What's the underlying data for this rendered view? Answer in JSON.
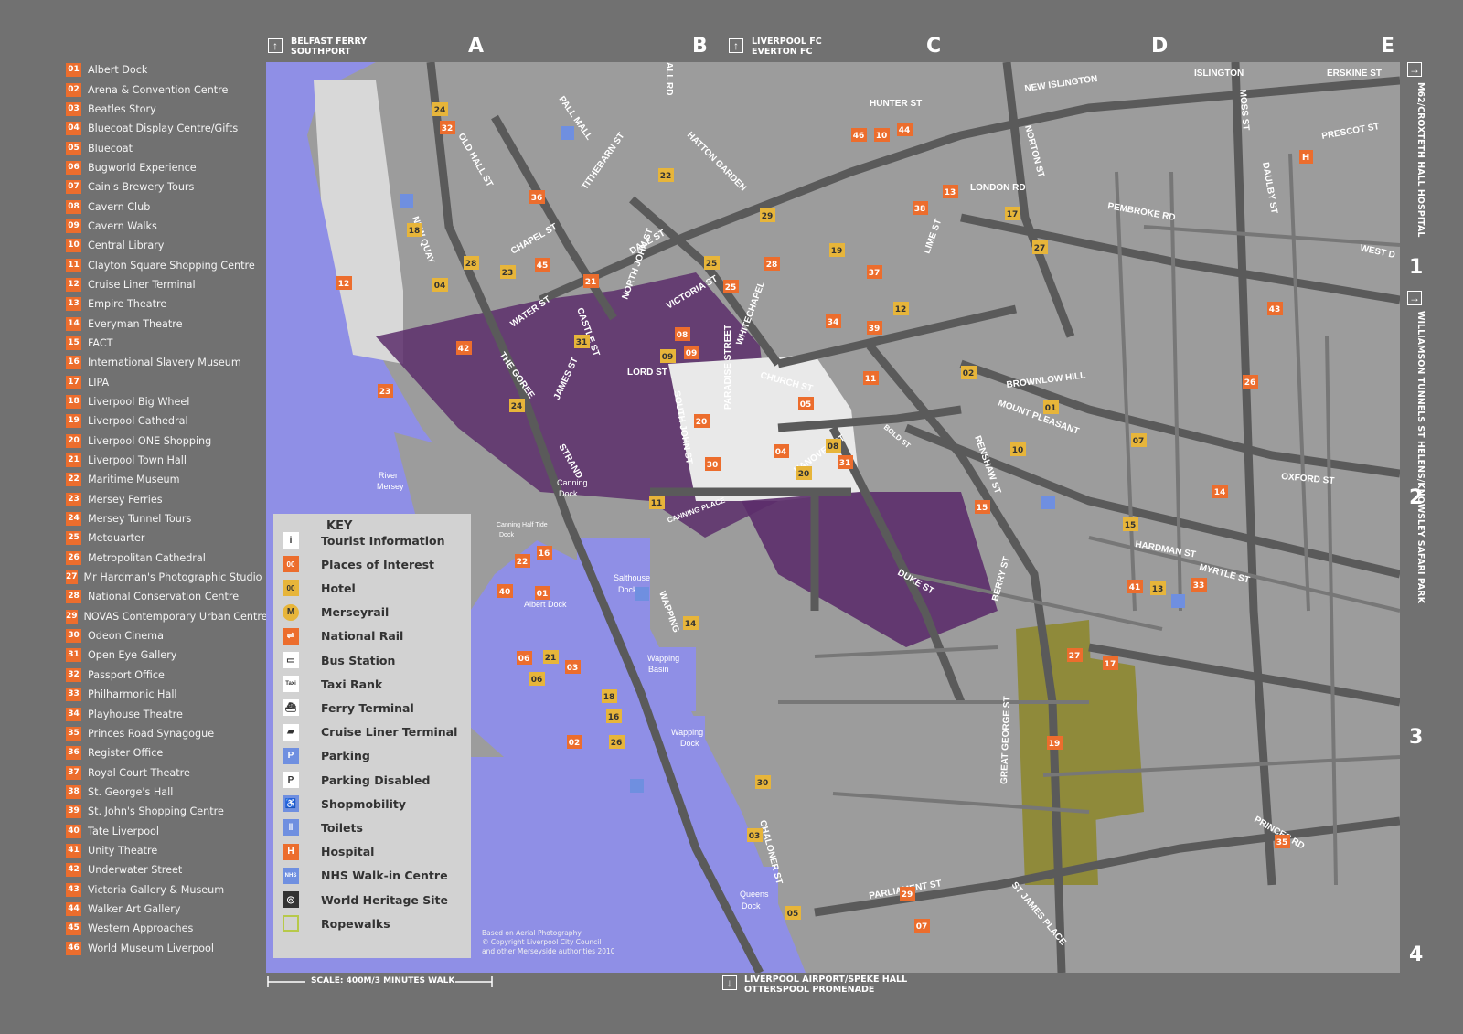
{
  "legend": [
    {
      "num": "01",
      "label": "Albert Dock"
    },
    {
      "num": "02",
      "label": "Arena & Convention Centre"
    },
    {
      "num": "03",
      "label": "Beatles Story"
    },
    {
      "num": "04",
      "label": "Bluecoat Display Centre/Gifts"
    },
    {
      "num": "05",
      "label": "Bluecoat"
    },
    {
      "num": "06",
      "label": "Bugworld Experience"
    },
    {
      "num": "07",
      "label": "Cain's Brewery Tours"
    },
    {
      "num": "08",
      "label": "Cavern Club"
    },
    {
      "num": "09",
      "label": "Cavern Walks"
    },
    {
      "num": "10",
      "label": "Central Library"
    },
    {
      "num": "11",
      "label": "Clayton Square Shopping Centre"
    },
    {
      "num": "12",
      "label": "Cruise Liner Terminal"
    },
    {
      "num": "13",
      "label": "Empire Theatre"
    },
    {
      "num": "14",
      "label": "Everyman Theatre"
    },
    {
      "num": "15",
      "label": "FACT"
    },
    {
      "num": "16",
      "label": "International Slavery Museum"
    },
    {
      "num": "17",
      "label": "LIPA"
    },
    {
      "num": "18",
      "label": "Liverpool Big Wheel"
    },
    {
      "num": "19",
      "label": "Liverpool Cathedral"
    },
    {
      "num": "20",
      "label": "Liverpool ONE Shopping"
    },
    {
      "num": "21",
      "label": "Liverpool Town Hall"
    },
    {
      "num": "22",
      "label": "Maritime Museum"
    },
    {
      "num": "23",
      "label": "Mersey Ferries"
    },
    {
      "num": "24",
      "label": "Mersey Tunnel Tours"
    },
    {
      "num": "25",
      "label": "Metquarter"
    },
    {
      "num": "26",
      "label": "Metropolitan Cathedral"
    },
    {
      "num": "27",
      "label": "Mr Hardman's Photographic Studio"
    },
    {
      "num": "28",
      "label": "National Conservation Centre"
    },
    {
      "num": "29",
      "label": "NOVAS Contemporary Urban Centre"
    },
    {
      "num": "30",
      "label": "Odeon Cinema"
    },
    {
      "num": "31",
      "label": "Open Eye Gallery"
    },
    {
      "num": "32",
      "label": "Passport Office"
    },
    {
      "num": "33",
      "label": "Philharmonic Hall"
    },
    {
      "num": "34",
      "label": "Playhouse Theatre"
    },
    {
      "num": "35",
      "label": "Princes Road Synagogue"
    },
    {
      "num": "36",
      "label": "Register Office"
    },
    {
      "num": "37",
      "label": "Royal Court Theatre"
    },
    {
      "num": "38",
      "label": "St. George's Hall"
    },
    {
      "num": "39",
      "label": "St. John's Shopping Centre"
    },
    {
      "num": "40",
      "label": "Tate Liverpool"
    },
    {
      "num": "41",
      "label": "Unity Theatre"
    },
    {
      "num": "42",
      "label": "Underwater Street"
    },
    {
      "num": "43",
      "label": "Victoria Gallery & Museum"
    },
    {
      "num": "44",
      "label": "Walker Art Gallery"
    },
    {
      "num": "45",
      "label": "Western Approaches"
    },
    {
      "num": "46",
      "label": "World Museum Liverpool"
    }
  ],
  "grid": {
    "columns": [
      "A",
      "B",
      "C",
      "D",
      "E"
    ],
    "rows": [
      "1",
      "2",
      "3",
      "4"
    ]
  },
  "edges": {
    "top_left": [
      "BELFAST FERRY",
      "SOUTHPORT"
    ],
    "top_mid": [
      "LIVERPOOL FC",
      "EVERTON FC"
    ],
    "right_top": "M62/CROXTETH HALL HOSPITAL",
    "right_mid": "WILLIAMSON TUNNELS ST HELENS/KNOWSLEY SAFARI PARK",
    "bottom": [
      "LIVERPOOL AIRPORT/SPEKE HALL",
      "OTTERSPOOL PROMENADE"
    ]
  },
  "key": {
    "title": "KEY",
    "items": [
      {
        "icon": "tourist-info-icon",
        "sym": "i",
        "label": "Tourist Information"
      },
      {
        "icon": "places-of-interest-icon",
        "sym": "00",
        "label": "Places of Interest"
      },
      {
        "icon": "hotel-icon",
        "sym": "00",
        "label": "Hotel"
      },
      {
        "icon": "merseyrail-icon",
        "sym": "M",
        "label": "Merseyrail"
      },
      {
        "icon": "national-rail-icon",
        "sym": "⇌",
        "label": "National Rail"
      },
      {
        "icon": "bus-station-icon",
        "sym": "▭",
        "label": "Bus Station"
      },
      {
        "icon": "taxi-rank-icon",
        "sym": "Taxi",
        "label": "Taxi Rank"
      },
      {
        "icon": "ferry-terminal-icon",
        "sym": "⛴",
        "label": "Ferry Terminal"
      },
      {
        "icon": "cruise-liner-terminal-icon",
        "sym": "▰",
        "label": "Cruise Liner Terminal"
      },
      {
        "icon": "parking-icon",
        "sym": "P",
        "label": "Parking"
      },
      {
        "icon": "parking-disabled-icon",
        "sym": "P",
        "label": "Parking Disabled"
      },
      {
        "icon": "shopmobility-icon",
        "sym": "♿",
        "label": "Shopmobility"
      },
      {
        "icon": "toilets-icon",
        "sym": "ǁ",
        "label": "Toilets"
      },
      {
        "icon": "hospital-icon",
        "sym": "H",
        "label": "Hospital"
      },
      {
        "icon": "nhs-walkin-icon",
        "sym": "NHS",
        "label": "NHS Walk-in Centre"
      },
      {
        "icon": "world-heritage-icon",
        "sym": "◎",
        "label": "World Heritage Site"
      },
      {
        "icon": "ropewalks-icon",
        "sym": "",
        "label": "Ropewalks"
      }
    ]
  },
  "scale": "SCALE: 400M/3 MINUTES WALK",
  "credit": [
    "Based on Aerial Photography",
    "© Copyright Liverpool City Council",
    "and other Merseyside authorities 2010"
  ],
  "map": {
    "water_labels": [
      "River",
      "Mersey",
      "Canning",
      "Dock",
      "Canning Half Tide",
      "Dock",
      "Salthouse",
      "Dock",
      "Albert Dock",
      "Wapping",
      "Basin",
      "Wapping",
      "Dock",
      "Queens",
      "Dock"
    ],
    "streets": [
      "NEW QUAY",
      "OLD HALL ST",
      "PALL MALL",
      "TITHEBARN ST",
      "HATTON GARDEN",
      "DALE ST",
      "NORTH JOHN ST",
      "VICTORIA ST",
      "WATER ST",
      "CASTLE ST",
      "JAMES ST",
      "THE GOREE",
      "STRAND",
      "WAPPING",
      "CHALONER ST",
      "LORD ST",
      "CHURCH ST",
      "SOUTH JOHN ST",
      "PARADISE STREET",
      "WHITECHAPEL",
      "HUNTER ST",
      "NEW ISLINGTON",
      "ISLINGTON",
      "ERSKINE ST",
      "PRESCOT ST",
      "LONDON RD",
      "PEMBROKE RD",
      "BROWNLOW HILL",
      "MOUNT PLEASANT",
      "OXFORD ST",
      "HARDMAN ST",
      "MYRTLE ST",
      "RENSHAW ST",
      "BERRY ST",
      "DUKE ST",
      "HANOVER ST",
      "PARLIAMENT ST",
      "ST JAMES PLACE",
      "PRINCES RD",
      "GREAT GEORGE ST",
      "CHAPEL ST",
      "LIME ST",
      "NORTON ST",
      "MOSS ST",
      "DAULBY ST",
      "WEST D",
      "CANNING PLACE",
      "BOLD ST",
      "ALL RD"
    ],
    "colors": {
      "river": "#8f8fe6",
      "road": "#5a5a5a",
      "block": "#9a9a9a",
      "purple": "#5c2e6b",
      "olive": "#8f8a3a",
      "orange": "#ec6d2d",
      "gold": "#e7b53a"
    }
  }
}
